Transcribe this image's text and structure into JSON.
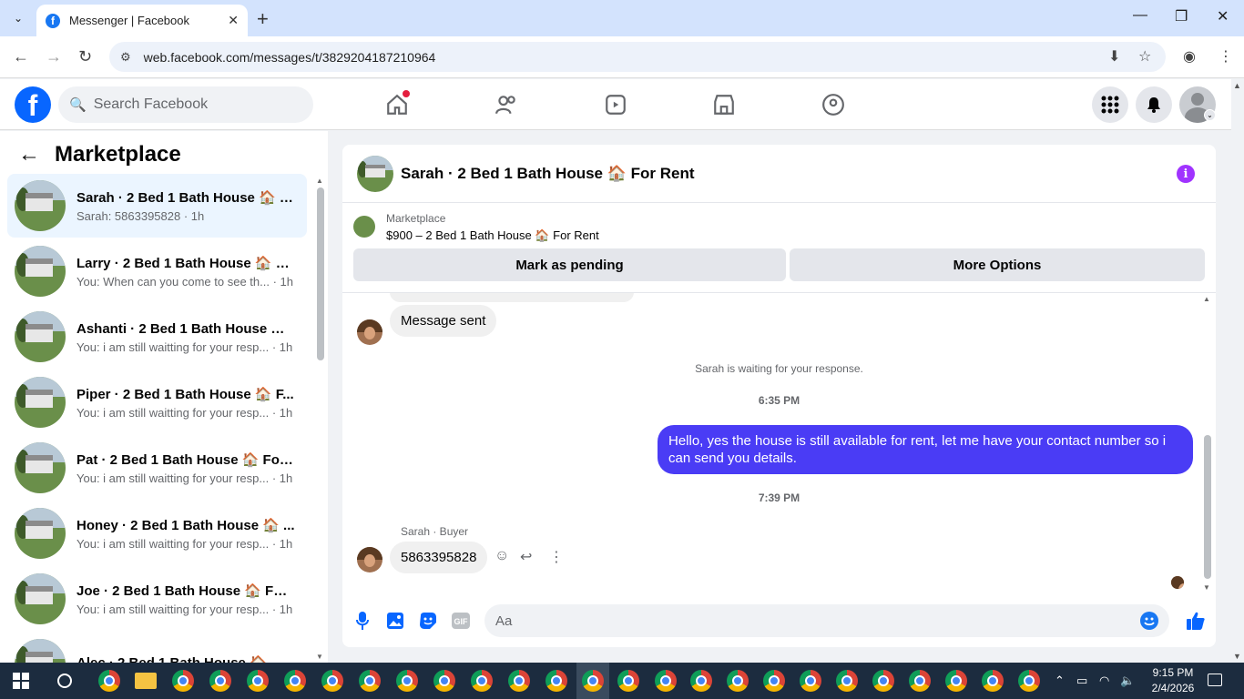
{
  "browser": {
    "tab_title": "Messenger | Facebook",
    "url": "web.facebook.com/messages/t/3829204187210964"
  },
  "fb": {
    "search_placeholder": "Search Facebook"
  },
  "sidebar": {
    "title": "Marketplace",
    "conversations": [
      {
        "name": "Sarah · 2 Bed 1 Bath House 🏠 F...",
        "snippet": "Sarah: 5863395828 · 1h",
        "active": true
      },
      {
        "name": "Larry · 2 Bed 1 Bath House 🏠 Fo...",
        "snippet": "You: When can you come to see th... · 1h"
      },
      {
        "name": "Ashanti · 2 Bed 1 Bath House 🏠 ...",
        "snippet": "You: i am still waitting for your resp... · 1h"
      },
      {
        "name": "Piper · 2 Bed 1 Bath House 🏠 F...",
        "snippet": "You: i am still waitting for your resp... · 1h"
      },
      {
        "name": "Pat · 2 Bed 1 Bath House 🏠 For ...",
        "snippet": "You: i am still waitting for your resp... · 1h"
      },
      {
        "name": "Honey · 2 Bed 1 Bath House 🏠 ...",
        "snippet": "You: i am still waitting for your resp... · 1h"
      },
      {
        "name": "Joe · 2 Bed 1 Bath House 🏠 For ...",
        "snippet": "You: i am still waitting for your resp... · 1h"
      },
      {
        "name": "Alec · 2 Bed 1 Bath House 🏠 ...",
        "snippet": ""
      }
    ]
  },
  "chat": {
    "title": "Sarah · 2 Bed 1 Bath House 🏠 For Rent",
    "listing_source": "Marketplace",
    "listing_title": "$900 – 2 Bed 1 Bath House 🏠 For Rent",
    "btn_pending": "Mark as pending",
    "btn_more": "More Options",
    "msg_sent": "Message sent",
    "waiting": "Sarah is waiting for your response.",
    "time1": "6:35 PM",
    "outgoing": "Hello, yes the house is still available for rent, let me have your contact number so i can send you  details.",
    "time2": "7:39 PM",
    "sender_label": "Sarah · Buyer",
    "incoming": "5863395828",
    "composer_placeholder": "Aa"
  },
  "taskbar": {
    "time": "9:15 PM",
    "date": "2/4/2026"
  },
  "colors": {
    "fb_blue": "#0866ff",
    "outgoing_bubble": "#4a3cf5",
    "info_purple": "#a033ff"
  }
}
